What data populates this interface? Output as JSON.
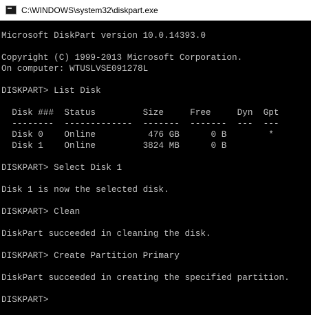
{
  "window": {
    "title": "C:\\WINDOWS\\system32\\diskpart.exe",
    "icon": "console-app-icon"
  },
  "console": {
    "lines": [
      "Microsoft DiskPart version 10.0.14393.0",
      "",
      "Copyright (C) 1999-2013 Microsoft Corporation.",
      "On computer: WTUSLVSE091278L",
      "",
      "DISKPART> List Disk",
      "",
      "  Disk ###  Status         Size     Free     Dyn  Gpt",
      "  --------  -------------  -------  -------  ---  ---",
      "  Disk 0    Online          476 GB      0 B        *",
      "  Disk 1    Online         3824 MB      0 B",
      "",
      "DISKPART> Select Disk 1",
      "",
      "Disk 1 is now the selected disk.",
      "",
      "DISKPART> Clean",
      "",
      "DiskPart succeeded in cleaning the disk.",
      "",
      "DISKPART> Create Partition Primary",
      "",
      "DiskPart succeeded in creating the specified partition.",
      "",
      "DISKPART> "
    ]
  }
}
